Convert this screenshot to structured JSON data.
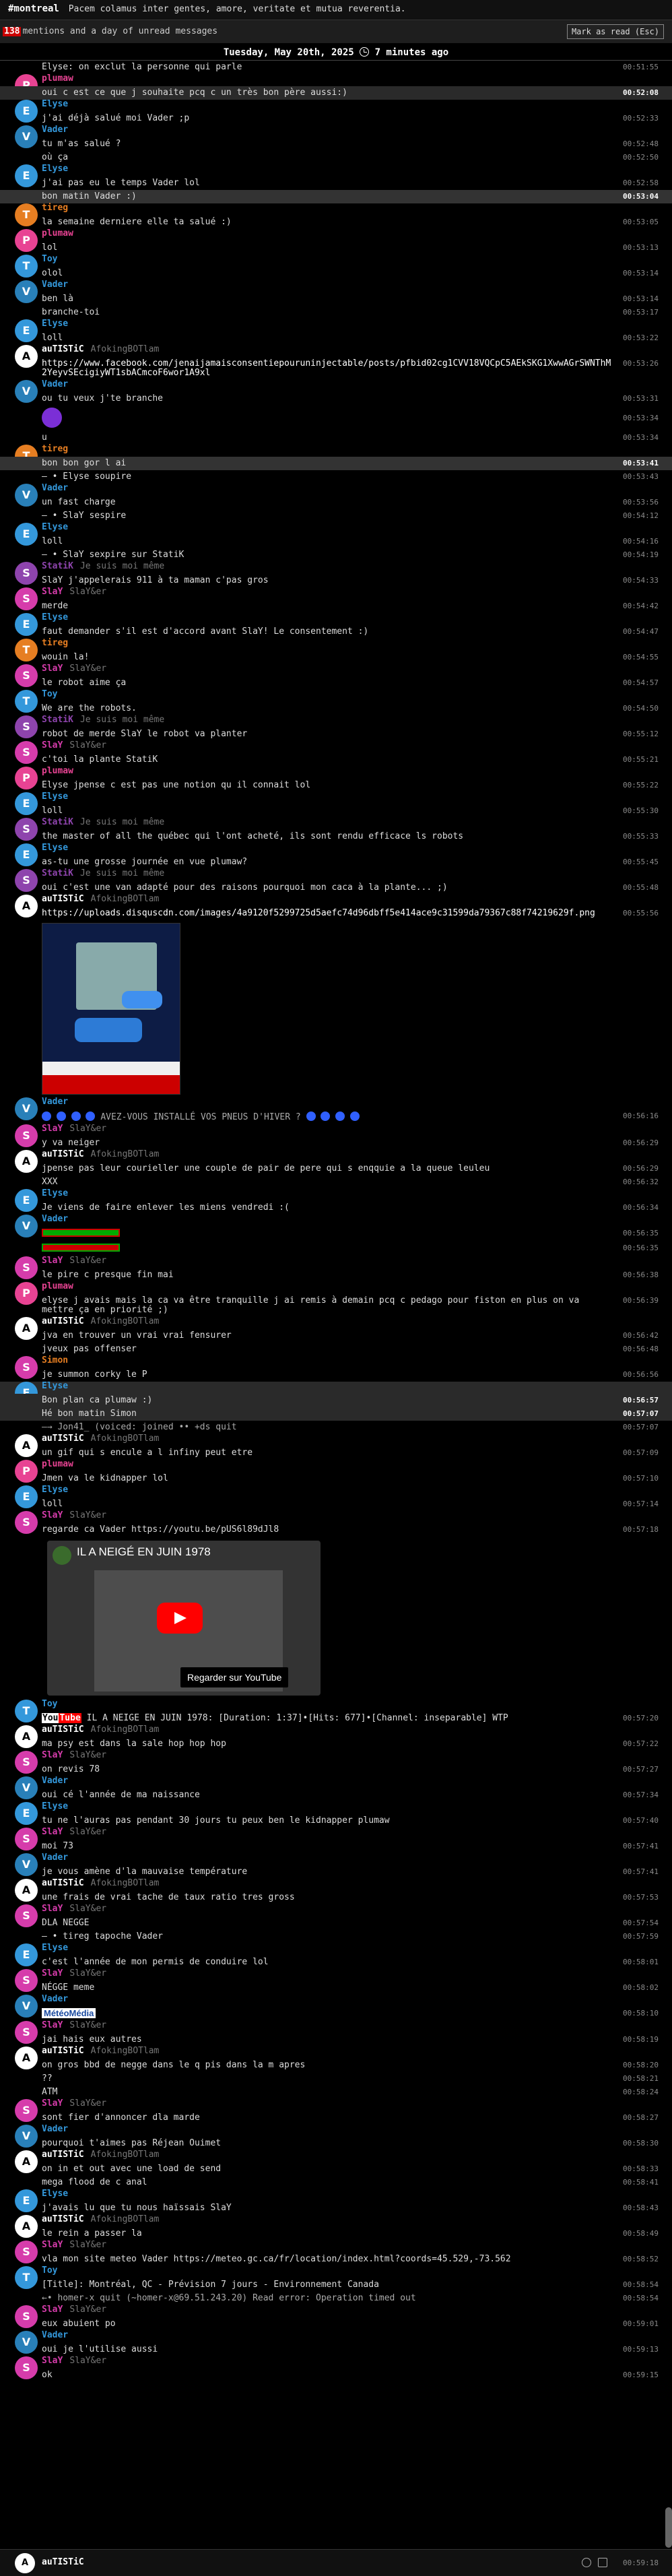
{
  "header": {
    "channel": "#montreal",
    "topic": "Pacem colamus inter gentes, amore, veritate et mutua reverentia."
  },
  "notice": {
    "count": "138",
    "text": "mentions and a day of unread messages",
    "mark_read": "Mark as read (Esc)"
  },
  "datebar": {
    "text": "Tuesday, May 20th, 2025",
    "ago": "7 minutes ago"
  },
  "colors": {
    "T": "#e67e22",
    "P": "#e84393",
    "E": "#3498db",
    "V": "#2980b9",
    "A": "#fff",
    "S": "#8e44ad",
    "Y": "#3498db"
  },
  "nicks": {
    "elyse": "Elyse",
    "plumaw": "plumaw",
    "vader": "Vader",
    "tireg": "tireg",
    "toy": "Toy",
    "autistic": "auTISTiC",
    "statik": "StatiK",
    "slay": "SlaY",
    "simon": "Simon"
  },
  "real": {
    "autistic": "AfokingBOTlam",
    "statik": "Je suis moi même",
    "slay": "SlaY&er"
  },
  "msgs": {
    "m1": "Elyse: on exclut la personne qui parle",
    "t1": "00:51:55",
    "m2": "oui c est ce que j souhaite pcq c un très bon père aussi:)",
    "t2": "00:52:08",
    "m3": "j'ai déjà salué moi Vader ;p",
    "t3": "00:52:33",
    "m4": "tu m'as salué ?",
    "t4": "00:52:48",
    "m5": "où ça",
    "t5": "00:52:50",
    "m6": "j'ai pas eu le temps Vader lol",
    "t6": "00:52:58",
    "m7": "bon matin Vader :)",
    "t7": "00:53:04",
    "m8": "la semaine derniere elle ta salué :)",
    "t8": "00:53:05",
    "m9": "lol",
    "t9": "00:53:13",
    "m10": "olol",
    "t10": "00:53:14",
    "m11": "ben là",
    "t11": "00:53:14",
    "m12": "branche-toi",
    "t12": "00:53:17",
    "m13": "loll",
    "t13": "00:53:22",
    "m14": "https://www.facebook.com/jenaijamaisconsentiepouruninjectable/posts/pfbid02cg1CVV18VQCpC5AEkSKG1XwwAGrSWNThM2YeyvSEcigiyWT1sbACmcoF6wor1A9xl",
    "t14": "00:53:26",
    "m15": "ou tu veux j'te branche",
    "t15": "00:53:31",
    "m16": "u",
    "t16": "00:53:34",
    "m17": "bon bon gor l ai",
    "t17": "00:53:41",
    "m18": "— • Elyse soupire",
    "t18": "00:53:43",
    "m19": "un fast charge",
    "t19": "00:53:56",
    "m20": "— • SlaY sespire",
    "t20": "00:54:12",
    "m21": "loll",
    "t21": "00:54:16",
    "m22": "— • SlaY sexpire sur StatiK",
    "t22": "00:54:19",
    "m23": "SlaY j'appelerais 911 à ta maman c'pas gros",
    "t23": "00:54:33",
    "m24": "merde",
    "t24": "00:54:42",
    "m25": "faut demander s'il est d'accord avant SlaY! Le consentement :)",
    "t25": "00:54:47",
    "m26": "wouin la!",
    "t26": "00:54:55",
    "m27": "le robot aime ça",
    "t27": "00:54:57",
    "m28": "We are the robots.",
    "t28": "00:54:50",
    "m29": "robot de merde SlaY le robot va planter",
    "t29": "00:55:12",
    "m30": "c'toi la plante StatiK",
    "t30": "00:55:21",
    "m31": "Elyse jpense c est pas une notion qu il connait lol",
    "t31": "00:55:22",
    "m32": "loll",
    "t32": "00:55:30",
    "m33": "the master of all the québec qui l'ont acheté, ils sont rendu efficace ls robots",
    "t33": "00:55:33",
    "m34": "as-tu une grosse journée en vue plumaw?",
    "t34": "00:55:45",
    "m35": "oui c'est une van adapté pour des raisons pourquoi mon caca à la plante... ;)",
    "t35": "00:55:48",
    "m36": "https://uploads.disquscdn.com/images/4a9120f5299725d5aefc74d96dbff5e414ace9c31599da79367c88f74219629f.png",
    "t36": "00:55:56",
    "m37": "AVEZ-VOUS INSTALLÉ VOS PNEUS D'HIVER ?",
    "t37": "00:56:16",
    "m38": "y va neiger",
    "t38": "00:56:29",
    "m39": "jpense pas leur courieller une couple de pair de pere qui s enqquie a la queue leuleu",
    "t39": "00:56:29",
    "m40": "XXX",
    "t40": "00:56:32",
    "m41": "Je viens de faire enlever les miens vendredi :(",
    "t41": "00:56:34",
    "m42": "le pire c presque fin mai",
    "t42": "00:56:38",
    "m43": "elyse j avais mais la ca va être tranquille j ai remis à demain pcq c pedago pour fiston en plus on va mettre ça en priorité ;)",
    "t43": "00:56:39",
    "m44": "jva en trouver un vrai vrai fensurer",
    "t44": "00:56:42",
    "m45": "jveux pas offenser",
    "t45": "00:56:48",
    "m46": "je summon corky le P",
    "t46": "00:56:56",
    "m47": "Bon plan ca plumaw :)",
    "t47": "00:56:57",
    "m48": "Hé bon matin Simon",
    "t48": "00:57:07",
    "m49": "—→ Jon41_ (voiced: joined  •• +ds quit",
    "t49": "00:57:07",
    "m50": "un gif qui s encule a l infiny peut etre",
    "t50": "00:57:09",
    "m51": "Jmen va le kidnapper lol",
    "t51": "00:57:10",
    "m52": "loll",
    "t52": "00:57:14",
    "m53": "regarde ca Vader https://youtu.be/pUS6l89dJl8",
    "t53": "00:57:18",
    "yt_title": "IL A NEIGÉ EN JUIN 1978",
    "yt_watch": "Regarder sur  YouTube",
    "m54": "IL A NEIGE EN JUIN 1978: [Duration: 1:37]•[Hits: 677]•[Channel: inseparable] WTP",
    "t54": "00:57:20",
    "m55": "ma psy est dans la sale hop hop hop",
    "t55": "00:57:22",
    "m56": "on revis 78",
    "t56": "00:57:27",
    "m57": "oui cé l'année de ma naissance",
    "t57": "00:57:34",
    "m58": "tu ne l'auras pas pendant 30 jours tu peux ben le kidnapper plumaw",
    "t58": "00:57:40",
    "m59": "moi 73",
    "t59": "00:57:41",
    "m60": "je vous amène d'la mauvaise température",
    "t60": "00:57:41",
    "m61": "une frais de vrai tache de taux ratio tres gross",
    "t61": "00:57:53",
    "m62": "DLA NEGGE",
    "t62": "00:57:54",
    "m63": "— • tireg tapoche Vader",
    "t63": "00:57:59",
    "m64": "c'est l'année de mon permis de conduire lol",
    "t64": "00:58:01",
    "m65": "NÉGGE meme",
    "t65": "00:58:02",
    "m66": "MétéoMédia",
    "t66": "00:58:10",
    "m67": "jai hais eux autres",
    "t67": "00:58:19",
    "m68": "on gros bbd de negge dans le q pis dans la m apres",
    "t68": "00:58:20",
    "m69": "??",
    "t69": "00:58:21",
    "m70": "ATM",
    "t70": "00:58:24",
    "m71": "sont fier d'annoncer dla marde",
    "t71": "00:58:27",
    "m72": "pourquoi t'aimes pas Réjean Ouimet",
    "t72": "00:58:30",
    "m73": "on in et out avec une load de send",
    "t73": "00:58:33",
    "m74": "mega flood de c anal",
    "t74": "00:58:41",
    "m75": "j'avais lu que tu nous haïssais SlaY",
    "t75": "00:58:43",
    "m76": "le rein a passer la",
    "t76": "00:58:49",
    "m77": "vla mon site meteo Vader https://meteo.gc.ca/fr/location/index.html?coords=45.529,-73.562",
    "t77": "00:58:52",
    "m78": "[Title]: Montréal, QC - Prévision 7 jours - Environnement Canada",
    "t78": "00:58:54",
    "m79": "←• homer-x quit (~homer-x@69.51.243.20) Read error: Operation timed out",
    "t79": "00:58:54",
    "m80": "eux abuient po",
    "t80": "00:59:01",
    "m81": "oui je l'utilise aussi",
    "t81": "00:59:13",
    "m82": "ok",
    "t82": "00:59:15"
  },
  "input": {
    "nick": "auTISTiC",
    "time": "00:59:18"
  }
}
